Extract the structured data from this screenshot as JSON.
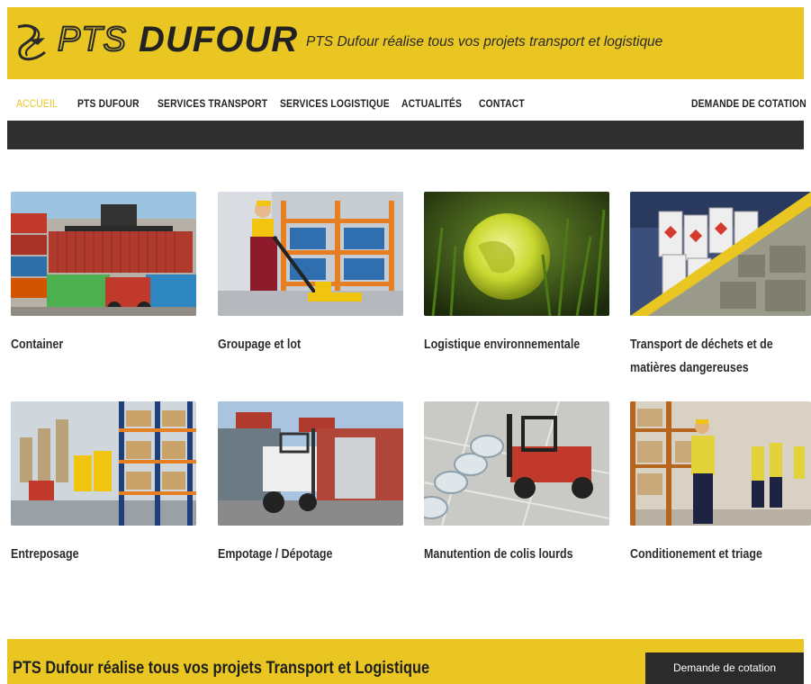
{
  "brand": {
    "logo_pts": "PTS",
    "logo_dufour": "DUFOUR",
    "tagline": "PTS Dufour réalise tous vos projets transport et logistique"
  },
  "nav": {
    "items": [
      {
        "label": "ACCUEIL",
        "active": true
      },
      {
        "label": "PTS DUFOUR",
        "active": false
      },
      {
        "label": "SERVICES TRANSPORT",
        "active": false
      },
      {
        "label": "SERVICES LOGISTIQUE",
        "active": false
      },
      {
        "label": "ACTUALITÉS",
        "active": false
      },
      {
        "label": "CONTACT",
        "active": false
      }
    ],
    "cta": "DEMANDE DE COTATION"
  },
  "services": [
    {
      "title": "Container",
      "image": "container-image"
    },
    {
      "title": "Groupage et lot",
      "image": "groupage-image"
    },
    {
      "title": "Logistique environnementale",
      "image": "globe-image"
    },
    {
      "title": "Transport de déchets et de matières dangereuses",
      "image": "waste-image"
    },
    {
      "title": "Entreposage",
      "image": "warehouse-image"
    },
    {
      "title": "Empotage / Dépotage",
      "image": "forklift-container-image"
    },
    {
      "title": "Manutention de colis lourds",
      "image": "heavy-forklift-image"
    },
    {
      "title": "Conditionement et triage",
      "image": "workers-image"
    }
  ],
  "banner": {
    "text": "PTS Dufour réalise tous vos projets Transport et Logistique",
    "button_label": "Demande de cotation"
  },
  "colors": {
    "brand_yellow": "#e9c622",
    "dark_bar": "#2f2f2f",
    "text_dark": "#2b2b2b"
  }
}
